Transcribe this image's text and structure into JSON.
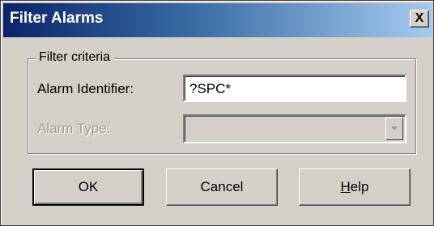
{
  "dialog": {
    "title": "Filter Alarms",
    "close_label": "X"
  },
  "filter_criteria": {
    "group_label": "Filter criteria",
    "alarm_identifier_label": "Alarm Identifier:",
    "alarm_identifier_value": "?SPC*",
    "alarm_type_label": "Alarm Type:",
    "alarm_type_value": "",
    "alarm_type_disabled": true
  },
  "buttons": {
    "ok_label": "OK",
    "cancel_label": "Cancel",
    "help_mnemonic": "H",
    "help_rest": "elp"
  },
  "icons": {
    "close": "close-icon",
    "dropdown": "chevron-down-icon"
  },
  "colors": {
    "title_bar_start": "#0a246a",
    "title_bar_end": "#a6caf0",
    "dialog_face": "#d4d0c8",
    "disabled_text": "#a09c94"
  }
}
